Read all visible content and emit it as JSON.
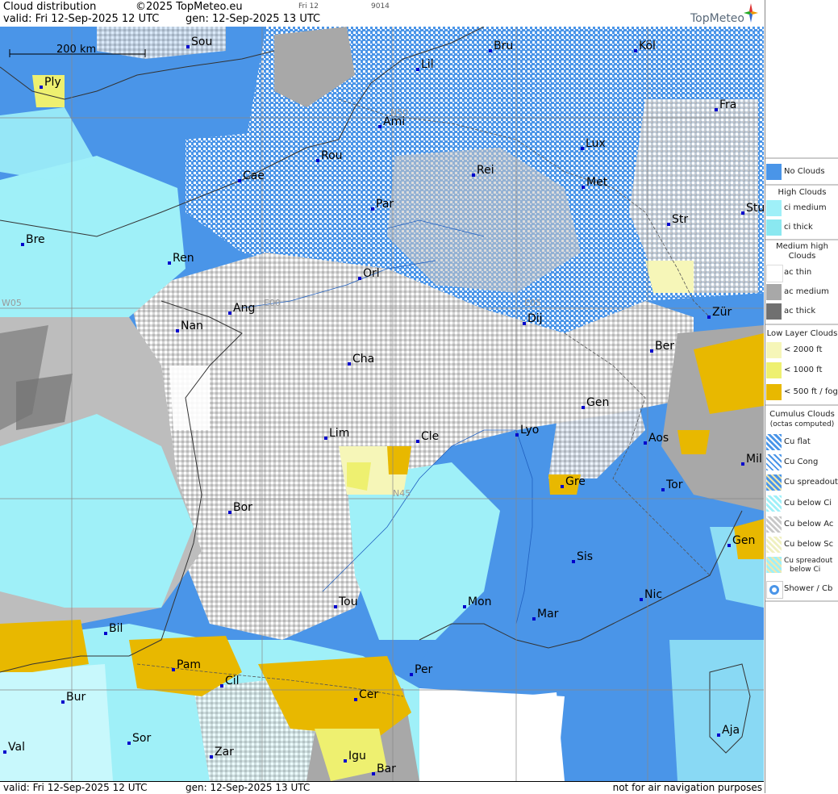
{
  "header": {
    "title": "Cloud distribution",
    "copyright": "©2025 TopMeteo.eu",
    "small_day": "Fri 12",
    "small_code": "9014",
    "valid": "valid:  Fri  12-Sep-2025  12 UTC",
    "gen": "gen: 12-Sep-2025 13 UTC",
    "logo": "TopMeteo"
  },
  "footer": {
    "valid": "valid:  Fri  12-Sep-2025  12 UTC",
    "gen": "gen: 12-Sep-2025 13 UTC",
    "note": "not for air navigation purposes"
  },
  "map": {
    "scale_label": "200 km",
    "grid_labels": [
      "N50",
      "W05",
      "E00",
      "E05",
      "N45"
    ],
    "cities": [
      {
        "name": "Sou"
      },
      {
        "name": "Bru"
      },
      {
        "name": "Köl"
      },
      {
        "name": "Lil"
      },
      {
        "name": "Ply"
      },
      {
        "name": "Ami"
      },
      {
        "name": "Fra"
      },
      {
        "name": "Rou"
      },
      {
        "name": "Lux"
      },
      {
        "name": "Cae"
      },
      {
        "name": "Rei"
      },
      {
        "name": "Met"
      },
      {
        "name": "Par"
      },
      {
        "name": "Stu"
      },
      {
        "name": "Str"
      },
      {
        "name": "Bre"
      },
      {
        "name": "Ren"
      },
      {
        "name": "Orl"
      },
      {
        "name": "Ang"
      },
      {
        "name": "Dij"
      },
      {
        "name": "Zür"
      },
      {
        "name": "Nan"
      },
      {
        "name": "Ber"
      },
      {
        "name": "Cha"
      },
      {
        "name": "Gen"
      },
      {
        "name": "Lim"
      },
      {
        "name": "Cle"
      },
      {
        "name": "Lyo"
      },
      {
        "name": "Aos"
      },
      {
        "name": "Mil"
      },
      {
        "name": "Gre"
      },
      {
        "name": "Tor"
      },
      {
        "name": "Bor"
      },
      {
        "name": "Gen"
      },
      {
        "name": "Sis"
      },
      {
        "name": "Nic"
      },
      {
        "name": "Tou"
      },
      {
        "name": "Mon"
      },
      {
        "name": "Mar"
      },
      {
        "name": "Bil"
      },
      {
        "name": "Pam"
      },
      {
        "name": "Per"
      },
      {
        "name": "Cil"
      },
      {
        "name": "Cer"
      },
      {
        "name": "Bur"
      },
      {
        "name": "Sor"
      },
      {
        "name": "Aja"
      },
      {
        "name": "Val"
      },
      {
        "name": "Zar"
      },
      {
        "name": "Igu"
      },
      {
        "name": "Bar"
      }
    ]
  },
  "legend": {
    "no_clouds": "No Clouds",
    "high_title": "High Clouds",
    "ci_medium": "ci medium",
    "ci_thick": "ci thick",
    "medium_title": "Medium high Clouds",
    "ac_thin": "ac thin",
    "ac_medium": "ac medium",
    "ac_thick": "ac thick",
    "low_title": "Low Layer Clouds",
    "low_2000": "< 2000 ft",
    "low_1000": "< 1000 ft",
    "low_500": "< 500 ft / fog",
    "cu_title": "Cumulus Clouds",
    "cu_subtitle": "(octas computed)",
    "cu_flat": "Cu flat",
    "cu_cong": "Cu Cong",
    "cu_spreadout": "Cu spreadout",
    "cu_below_ci": "Cu below Ci",
    "cu_below_ac": "Cu below Ac",
    "cu_below_sc": "Cu below Sc",
    "cu_spreadout_below_ci_1": "Cu spreadout",
    "cu_spreadout_below_ci_2": "below Ci",
    "shower": "Shower / Cb"
  },
  "colors": {
    "no_clouds": "#4a95e8",
    "ci_medium": "#9ff0f8",
    "ci_thick": "#8ae8f0",
    "ac_thin": "#ffffff",
    "ac_medium": "#a8a8a8",
    "ac_thick": "#707070",
    "low_2000": "#f6f6b8",
    "low_1000": "#eef070",
    "low_500": "#e8b800",
    "cu_dots": "#ffffff"
  }
}
